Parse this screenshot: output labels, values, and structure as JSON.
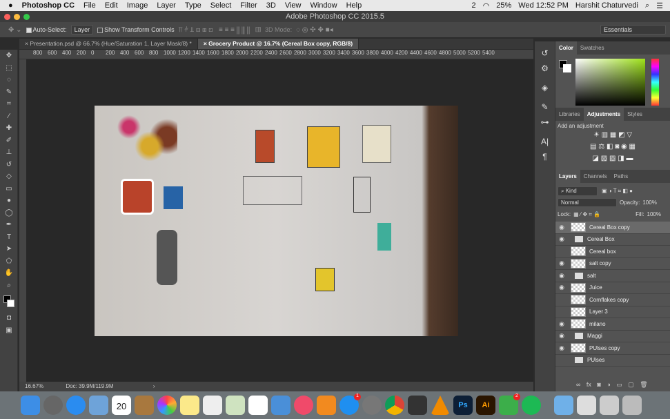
{
  "menubar": {
    "apple": "",
    "app": "Photoshop CC",
    "items": [
      "File",
      "Edit",
      "Image",
      "Layer",
      "Type",
      "Select",
      "Filter",
      "3D",
      "View",
      "Window",
      "Help"
    ],
    "battery": "25%",
    "clock": "Wed 12:52 PM",
    "user": "Harshit Chaturvedi",
    "notif": "2"
  },
  "window": {
    "title": "Adobe Photoshop CC 2015.5"
  },
  "options": {
    "auto_select": "Auto-Select:",
    "layer_select": "Layer",
    "show_transform": "Show Transform Controls",
    "mode3d": "3D Mode:",
    "workspace": "Essentials"
  },
  "tabs": [
    {
      "label": "Presentation.psd @ 66.7% (Hue/Saturation 1, Layer Mask/8) *"
    },
    {
      "label": "Grocery Product @ 16.7% (Cereal Box copy, RGB/8)"
    }
  ],
  "ruler": [
    "800",
    "600",
    "400",
    "200",
    "0",
    "200",
    "400",
    "600",
    "800",
    "1000",
    "1200",
    "1400",
    "1600",
    "1800",
    "2000",
    "2200",
    "2400",
    "2600",
    "2800",
    "3000",
    "3200",
    "3400",
    "3600",
    "3800",
    "4000",
    "4200",
    "4400",
    "4600",
    "4800",
    "5000",
    "5200",
    "5400"
  ],
  "status": {
    "zoom": "16.67%",
    "doc": "Doc: 39.9M/119.9M"
  },
  "color_panel": {
    "tabs": [
      "Color",
      "Swatches"
    ],
    "hue": "#9ee21a"
  },
  "adjust_panel": {
    "tabs": [
      "Libraries",
      "Adjustments",
      "Styles"
    ],
    "heading": "Add an adjustment"
  },
  "layers_panel": {
    "tabs": [
      "Layers",
      "Channels",
      "Paths"
    ],
    "kind": "Kind",
    "blend": "Normal",
    "opacity_label": "Opacity:",
    "opacity": "100%",
    "lock_label": "Lock:",
    "fill_label": "Fill:",
    "fill": "100%",
    "layers": [
      {
        "name": "Cereal Box copy",
        "visible": true,
        "type": "smart",
        "selected": true
      },
      {
        "name": "Cereal Box",
        "visible": true,
        "type": "group"
      },
      {
        "name": "Cereal box",
        "visible": false,
        "type": "smart"
      },
      {
        "name": "salt copy",
        "visible": true,
        "type": "smart"
      },
      {
        "name": "salt",
        "visible": true,
        "type": "group"
      },
      {
        "name": "Juice",
        "visible": true,
        "type": "smart"
      },
      {
        "name": "Cornflakes copy",
        "visible": false,
        "type": "smart"
      },
      {
        "name": "Layer 3",
        "visible": false,
        "type": "pixel"
      },
      {
        "name": "milano",
        "visible": true,
        "type": "pixel"
      },
      {
        "name": "Maggi",
        "visible": true,
        "type": "group"
      },
      {
        "name": "PUlses copy",
        "visible": true,
        "type": "smart"
      },
      {
        "name": "PUlses",
        "visible": false,
        "type": "group"
      }
    ]
  },
  "dock": {
    "calendar_day": "20",
    "appstore_badge": "1",
    "badge2": "2",
    "ps": "Ps",
    "ai": "Ai"
  }
}
